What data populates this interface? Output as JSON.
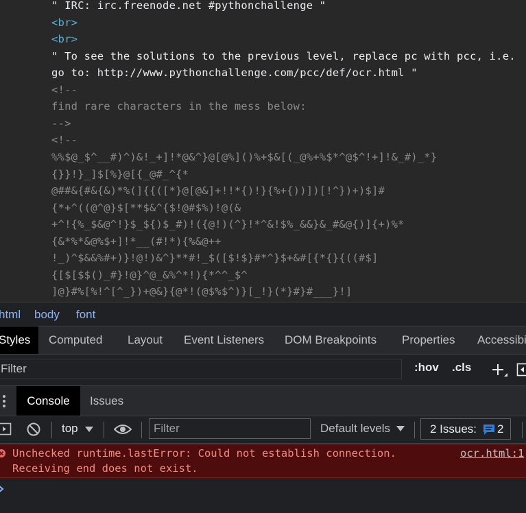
{
  "source": {
    "lines": [
      {
        "text": "\" IRC: irc.freenode.net #pythonchallenge \"",
        "kind": "text"
      },
      {
        "text": "<br>",
        "kind": "tag"
      },
      {
        "text": "<br>",
        "kind": "tag"
      },
      {
        "text": "\" To see the solutions to the previous level, replace pc with pcc, i.e.",
        "kind": "text"
      },
      {
        "text": "go to: http://www.pythonchallenge.com/pcc/def/ocr.html \"",
        "kind": "text"
      },
      {
        "text": "<!--",
        "kind": "comment"
      },
      {
        "text": "find rare characters in the mess below:",
        "kind": "comment"
      },
      {
        "text": "-->",
        "kind": "comment"
      },
      {
        "text": "<!--",
        "kind": "comment"
      },
      {
        "text": "%%$@_$^__#)^)&!_+]!*@&^}@[@%]()%+$&[(_@%+%$*^@$^!+]!&_#)_*}",
        "kind": "comment"
      },
      {
        "text": "{}}!}_]$[%}@[{_@#_^{*",
        "kind": "comment"
      },
      {
        "text": "@##&{#&{&)*%(]{{([*}@[@&]+!!*{)!}{%+{))])[!^})+)$]#",
        "kind": "comment"
      },
      {
        "text": "{*+^((@^@}$[**$&^{$!@#$%)!@(&",
        "kind": "comment"
      },
      {
        "text": "+^!{%_$&@^!}$_${)$_#)!({@!)(^}!*^&!$%_&&}&_#&@{)]{+)%*",
        "kind": "comment"
      },
      {
        "text": "{&*%*&@%$+]!*__(#!*){%&@++",
        "kind": "comment"
      },
      {
        "text": "!_)^$&&%#+)}!@!)&^}**#!_$([$!$}#*^}$+&#[{*{}{((#$]",
        "kind": "comment"
      },
      {
        "text": "{[$[$$()_#}!@}^@_&%^*!){*^^_$^",
        "kind": "comment"
      },
      {
        "text": "]@}#%[%!^[^_})+@&}{@*!(@$%$^)}[_!}(*}#}#___}!]",
        "kind": "comment"
      }
    ]
  },
  "breadcrumb": [
    "html",
    "body",
    "font"
  ],
  "styles_tabs": [
    "Styles",
    "Computed",
    "Layout",
    "Event Listeners",
    "DOM Breakpoints",
    "Properties",
    "Accessibility"
  ],
  "styles_filter": {
    "placeholder": "Filter",
    "hov": ":hov",
    "cls": ".cls",
    "add_icon": "plus-icon",
    "toggle_icon": "sidebar-toggle-icon"
  },
  "drawer": {
    "menu_icon": "kebab-menu-icon",
    "tabs": [
      "Console",
      "Issues"
    ]
  },
  "console_toolbar": {
    "context": "top",
    "filter_placeholder": "Filter",
    "levels": "Default levels",
    "issues_label": "2 Issues:",
    "issues_count": "2"
  },
  "error": {
    "line1": "Unchecked runtime.lastError: Could not establish connection.",
    "line2": "Receiving end does not exist.",
    "source": "ocr.html:1"
  },
  "colors": {
    "error_bg": "#4e0c0c",
    "error_text": "#f28b82",
    "tag": "#5db0d7",
    "link": "#8ab4f8"
  }
}
